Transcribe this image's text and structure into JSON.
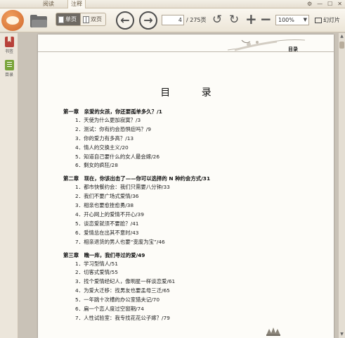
{
  "tabs": {
    "read": "阅读",
    "note": "注释"
  },
  "window_buttons": [
    "⚙",
    "—",
    "☐",
    "✕"
  ],
  "toolbar": {
    "single_page": "单页",
    "double_page": "双页",
    "current_page": "4",
    "total_pages": "/ 275页",
    "zoom": "100%",
    "slideshow": "幻灯片"
  },
  "sidebar": {
    "bookmark": "书签",
    "toc": "目录"
  },
  "page": {
    "running_header": "目录",
    "title": "目 录",
    "chapters": [
      {
        "heading": "第一章　亲爱的女孩，你还要孤单多久？/1",
        "items": [
          "1．天使为什么更加寂寞？/3",
          "2．测试：你有约会恐惧症吗？/9",
          "3．你的爱力有多高？/13",
          "4．情人的交换主义/20",
          "5．知道自己要什么的女人最会嫁/26",
          "6．剩女的疯狂/28"
        ]
      },
      {
        "heading": "第二章　现在，你该出击了——你可以选择的 N 种约会方式/31",
        "items": [
          "1．都市快餐约会：我们只需要八分钟/33",
          "2．我们不要广场式爱情/36",
          "3．相亲也要愈挫愈勇/38",
          "4．开心网上的爱情不开心/39",
          "5．谈恋爱就须不要脸？/41",
          "6．爱情总在出其不意时/43",
          "7．相亲退货的男人也要“变废为宝”/46"
        ]
      },
      {
        "heading": "第三章　瞧一库，我们寻过的爱/49",
        "items": [
          "1．学习型情人/51",
          "2．切客式爱情/55",
          "3．找个爱情经纪人，像明星一样谈恋爱/61",
          "4．为爱大迁移：找男友也要孟母三迁/65",
          "5．一年跳十次槽的办公室猎夫记/70",
          "6．扁一个恋人度过空窗期/74",
          "7．人性试验室：我专找花花公子嫁？/79"
        ]
      }
    ]
  }
}
